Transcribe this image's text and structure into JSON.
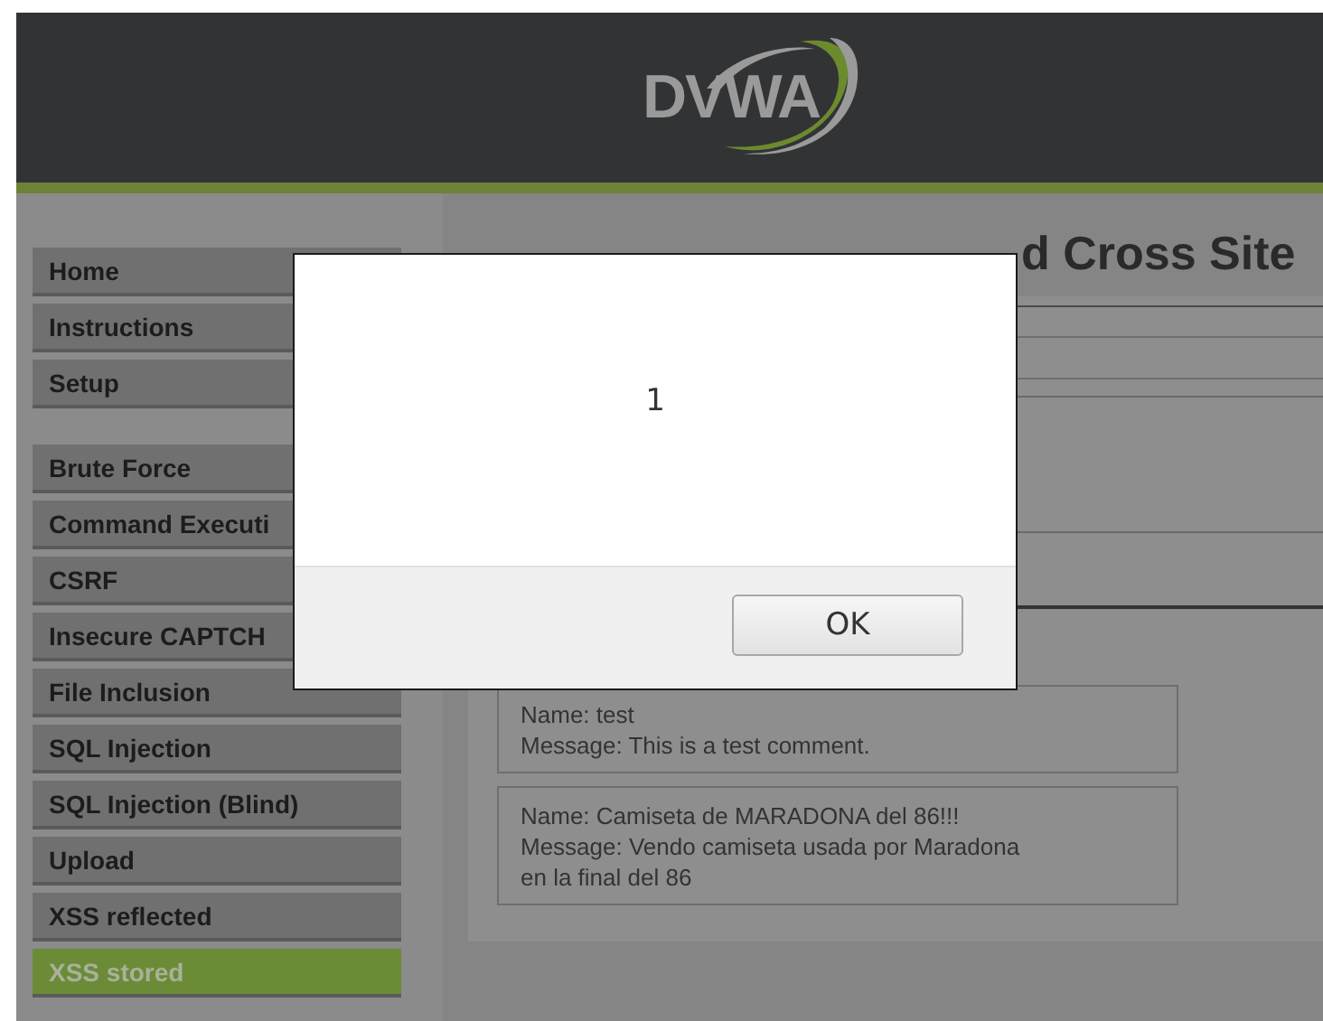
{
  "logo": {
    "text": "DVWA"
  },
  "sidebar": {
    "groups": [
      [
        {
          "label": "Home",
          "selected": false
        },
        {
          "label": "Instructions",
          "selected": false
        },
        {
          "label": "Setup",
          "selected": false
        }
      ],
      [
        {
          "label": "Brute Force",
          "selected": false
        },
        {
          "label": "Command Executi",
          "selected": false
        },
        {
          "label": "CSRF",
          "selected": false
        },
        {
          "label": "Insecure CAPTCH",
          "selected": false
        },
        {
          "label": "File Inclusion",
          "selected": false
        },
        {
          "label": "SQL Injection",
          "selected": false
        },
        {
          "label": "SQL Injection (Blind)",
          "selected": false
        },
        {
          "label": "Upload",
          "selected": false
        },
        {
          "label": "XSS reflected",
          "selected": false
        },
        {
          "label": "XSS stored",
          "selected": true
        }
      ]
    ]
  },
  "page_title": "d Cross Site",
  "comments": [
    {
      "lines": [
        "Name: test",
        "Message: This is a test comment."
      ]
    },
    {
      "lines": [
        "Name: Camiseta de MARADONA del 86!!!",
        "Message: Vendo camiseta usada por Maradona",
        "en la final del 86"
      ]
    }
  ],
  "alert": {
    "message": "1",
    "button": "OK"
  }
}
